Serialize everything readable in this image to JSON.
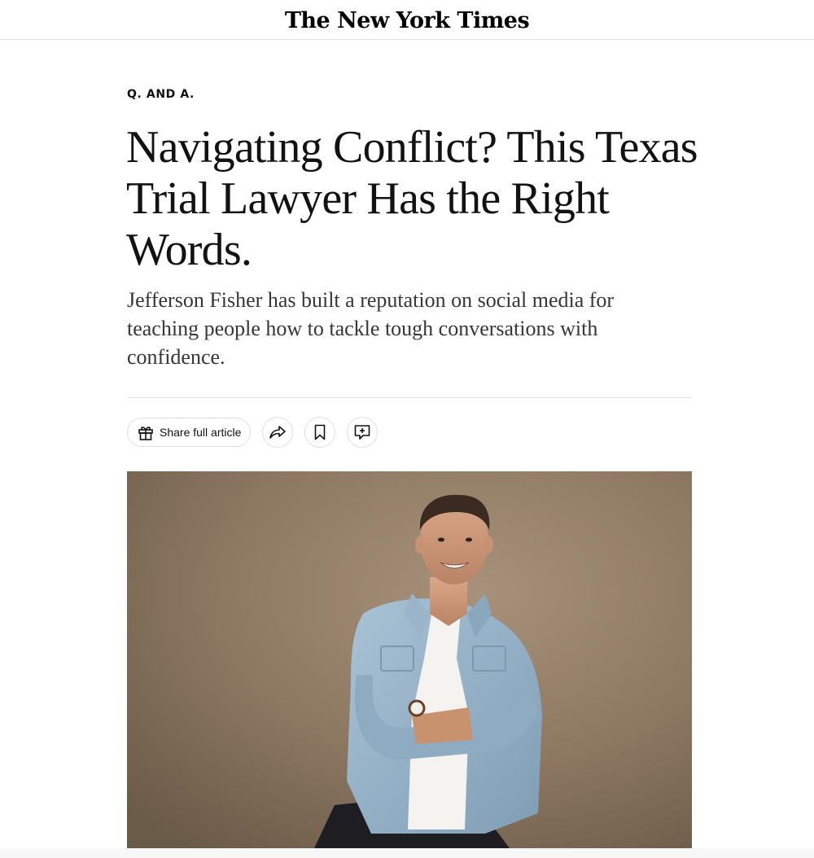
{
  "masthead": {
    "logo_text": "The New York Times"
  },
  "article": {
    "kicker": "Q. AND A.",
    "headline": "Navigating Conflict? This Texas Trial Lawyer Has the Right Words.",
    "summary": "Jefferson Fisher has built a reputation on social media for teaching people how to tackle tough conversations with confidence."
  },
  "share_bar": {
    "share_label": "Share full article",
    "share_icon": "gift-icon",
    "forward_icon": "share-arrow-icon",
    "save_icon": "bookmark-icon",
    "comment_icon": "comment-icon"
  },
  "hero": {
    "description_icon": "portrait-photo"
  }
}
